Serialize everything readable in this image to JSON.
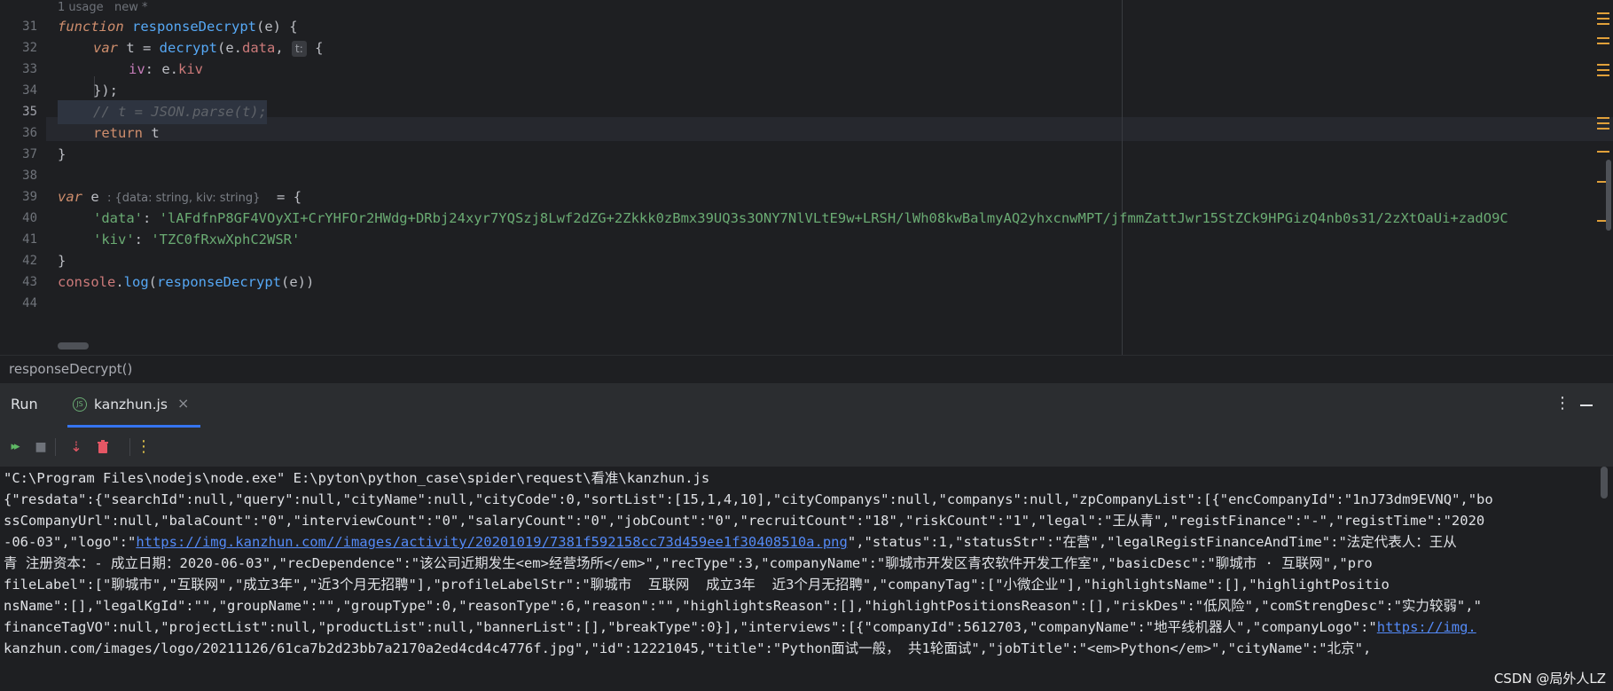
{
  "editor": {
    "usage_hint": "1 usage   new *",
    "line_numbers": [
      "31",
      "32",
      "33",
      "34",
      "35",
      "36",
      "37",
      "38",
      "39",
      "40",
      "41",
      "42",
      "43",
      "44"
    ],
    "lines": {
      "l31": {
        "kw": "function",
        "name": "responseDecrypt",
        "args": "(e) {"
      },
      "l32": {
        "kw": "var",
        "rest": " t = ",
        "fn": "decrypt",
        "args": "(e.",
        "prop": "data",
        "tail": ", ",
        "hint": "t:",
        "open": " {"
      },
      "l33": {
        "prop": "iv",
        "mid": ": e.",
        "val": "kiv"
      },
      "l34": {
        "text": "});"
      },
      "l35": {
        "comment": "// t = JSON.parse(t);"
      },
      "l36": {
        "kw": "return",
        "rest": " t"
      },
      "l37": {
        "text": "}"
      },
      "l39": {
        "kw": "var",
        "name": " e ",
        "hint": ": {data: string, kiv: string}",
        "rest": "  = {"
      },
      "l40": {
        "key": "'data'",
        "colon": ": ",
        "value": "'lAFdfnP8GF4VOyXI+CrYHFOr2HWdg+DRbj24xyr7YQSzj8Lwf2dZG+2Zkkk0zBmx39UQ3s3ONY7NlVLtE9w+LRSH/lWh08kwBalmyAQ2yhxcnwMPT/jfmmZattJwr15StZCk9HPGizQ4nb0s31/2zXtOaUi+zadO9C"
      },
      "l41": {
        "key": "'kiv'",
        "colon": ": ",
        "value": "'TZC0fRxwXphC2WSR'"
      },
      "l42": {
        "text": "}"
      },
      "l43": {
        "obj": "console",
        "dot": ".",
        "fn": "log",
        "open": "(",
        "fn2": "responseDecrypt",
        "args": "(e))"
      }
    }
  },
  "breadcrumb": "responseDecrypt()",
  "run_panel": {
    "title": "Run",
    "tab_label": "kanzhun.js",
    "tab_icon": "JS",
    "close": "×",
    "more": "⋮"
  },
  "toolbar": {
    "rerun": "▸▸",
    "stop": "■",
    "dump": "⇣",
    "delete": "🗑",
    "more": "⋮"
  },
  "console": {
    "cmd": "\"C:\\Program Files\\nodejs\\node.exe\" E:\\pyton\\python_case\\spider\\request\\看准\\kanzhun.js",
    "out1": "{\"resdata\":{\"searchId\":null,\"query\":null,\"cityName\":null,\"cityCode\":0,\"sortList\":[15,1,4,10],\"cityCompanys\":null,\"companys\":null,\"zpCompanyList\":[{\"encCompanyId\":\"1nJ73dm9EVNQ\",\"bo",
    "out2": "ssCompanyUrl\":null,\"balaCount\":\"0\",\"interviewCount\":\"0\",\"salaryCount\":\"0\",\"jobCount\":\"0\",\"recruitCount\":\"18\",\"riskCount\":\"1\",\"legal\":\"王从青\",\"registFinance\":\"-\",\"registTime\":\"2020",
    "out3_a": "-06-03\",\"logo\":\"",
    "out3_link": "https://img.kanzhun.com//images/activity/20201019/7381f592158cc73d459ee1f30408510a.png",
    "out3_b": "\",\"status\":1,\"statusStr\":\"在营\",\"legalRegistFinanceAndTime\":\"法定代表人：王从",
    "out4": "青 注册资本：- 成立日期：2020-06-03\",\"recDependence\":\"该公司近期发生<em>经营场所</em>\",\"recType\":3,\"companyName\":\"聊城市开发区青农软件开发工作室\",\"basicDesc\":\"聊城市 · 互联网\",\"pro",
    "out5": "fileLabel\":[\"聊城市\",\"互联网\",\"成立3年\",\"近3个月无招聘\"],\"profileLabelStr\":\"聊城市  互联网  成立3年  近3个月无招聘\",\"companyTag\":[\"小微企业\"],\"highlightsName\":[],\"highlightPositio",
    "out6": "nsName\":[],\"legalKgId\":\"\",\"groupName\":\"\",\"groupType\":0,\"reasonType\":6,\"reason\":\"\",\"highlightsReason\":[],\"highlightPositionsReason\":[],\"riskDes\":\"低风险\",\"comStrengDesc\":\"实力较弱\",\"",
    "out7_a": "financeTagVO\":null,\"projectList\":null,\"productList\":null,\"bannerList\":[],\"breakType\":0}],\"interviews\":[{\"companyId\":5612703,\"companyName\":\"地平线机器人\",\"companyLogo\":\"",
    "out7_link": "https://img.",
    "out8": "kanzhun.com/images/logo/20211126/61ca7b2d23bb7a2170a2ed4cd4c4776f.jpg\",\"id\":12221045,\"title\":\"Python面试一般， 共1轮面试\",\"jobTitle\":\"<em>Python</em>\",\"cityName\":\"北京\","
  },
  "watermark": "CSDN @局外人LZ",
  "colors": {
    "accent": "#3574f0",
    "marker": "#e0a03a",
    "string": "#6aab73",
    "keyword": "#cf8e6d",
    "function": "#56a8f5"
  }
}
